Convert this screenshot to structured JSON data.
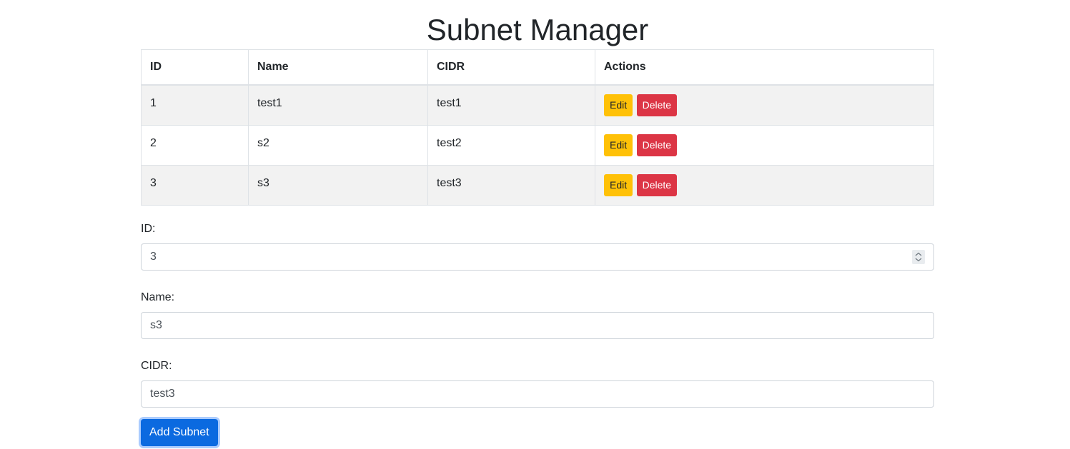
{
  "page": {
    "title": "Subnet Manager"
  },
  "table": {
    "headers": [
      "ID",
      "Name",
      "CIDR",
      "Actions"
    ],
    "rows": [
      {
        "id": "1",
        "name": "test1",
        "cidr": "test1",
        "edit": "Edit",
        "delete": "Delete"
      },
      {
        "id": "2",
        "name": "s2",
        "cidr": "test2",
        "edit": "Edit",
        "delete": "Delete"
      },
      {
        "id": "3",
        "name": "s3",
        "cidr": "test3",
        "edit": "Edit",
        "delete": "Delete"
      }
    ]
  },
  "form": {
    "id_label": "ID:",
    "id_value": "3",
    "name_label": "Name:",
    "name_value": "s3",
    "cidr_label": "CIDR:",
    "cidr_value": "test3",
    "submit_label": "Add Subnet"
  },
  "colors": {
    "edit_button": "#ffc107",
    "delete_button": "#dc3545",
    "primary_button": "#0b6ae0",
    "striped_row": "#f2f2f2"
  }
}
